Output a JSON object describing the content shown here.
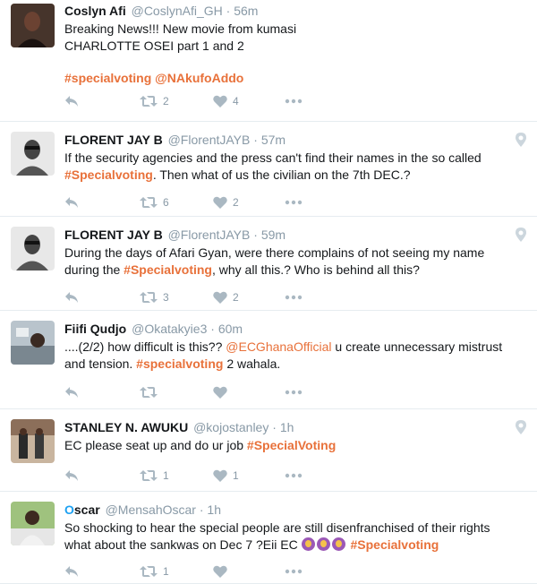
{
  "tweets": [
    {
      "name": "Coslyn Afi",
      "handle": "@CoslynAfi_GH",
      "time": "56m",
      "lines": [
        "Breaking News!!! New movie from kumasi",
        "CHARLOTTE OSEI part 1 and 2"
      ],
      "hashtag": "#specialvoting",
      "mention": "@NAkufoAddo",
      "retweets": "2",
      "likes": "4",
      "avatar_color": "#3b2a22"
    },
    {
      "name": "FLORENT JAY B",
      "handle": "@FlorentJAYB",
      "time": "57m",
      "text_a": "If the security agencies and the press can't find their names in the so called",
      "hashtag": "#Specialvoting",
      "text_b": ". Then what of us the civilian on the 7th DEC.?",
      "retweets": "6",
      "likes": "2",
      "avatar_color": "#5a5a5a"
    },
    {
      "name": "FLORENT JAY B",
      "handle": "@FlorentJAYB",
      "time": "59m",
      "text_a": "During the days of Afari Gyan, were there complains of not seeing my name",
      "text_b_pre": "during the ",
      "hashtag": "#Specialvoting",
      "text_b_post": ", why all this.? Who is behind all this?",
      "retweets": "3",
      "likes": "2",
      "avatar_color": "#5a5a5a"
    },
    {
      "name": "Fiifi Qudjo",
      "handle": "@Okatakyie3",
      "time": "60m",
      "text_a_pre": "....(2/2) how difficult is this?? ",
      "mention": "@ECGhanaOfficial",
      "text_a_post": " u create unnecessary mistrust",
      "text_b_pre": "and tension. ",
      "hashtag": "#specialvoting",
      "text_b_post": " 2 wahala.",
      "avatar_color": "#6d7a86"
    },
    {
      "name": "STANLEY N. AWUKU",
      "handle": "@kojostanley",
      "time": "1h",
      "text_pre": "EC please seat up and do ur job ",
      "hashtag": "#SpecialVoting",
      "retweets": "1",
      "likes": "1",
      "avatar_color": "#8a6a55"
    },
    {
      "name_o": "O",
      "name_rest": "scar",
      "handle": "@MensahOscar",
      "time": "1h",
      "text_a": "So shocking to hear the special people are still disenfranchised of their rights",
      "text_b_pre": "what about the sankwas on Dec 7 ?Eii EC ",
      "hashtag": "#Specialvoting",
      "retweets": "1",
      "avatar_color": "#4b7a3a"
    }
  ],
  "dot": "·"
}
